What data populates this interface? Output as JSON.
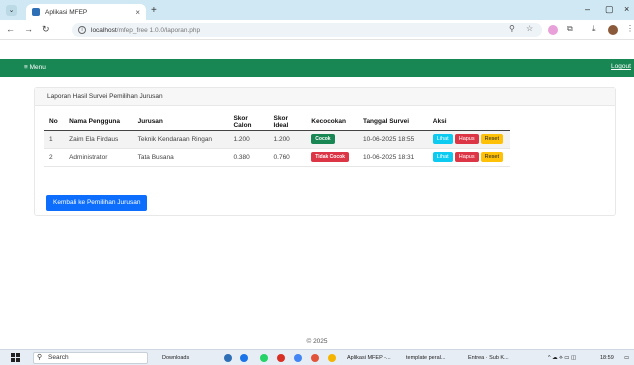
{
  "browser": {
    "tab_title": "Aplikasi MFEP",
    "tab_close": "×",
    "new_tab": "+",
    "url_host": "localhost",
    "url_path": "/mfep_free 1.0.0/laporan.php",
    "min": "–",
    "max": "▢",
    "close": "×"
  },
  "navbar": {
    "menu_label": "≡ Menu",
    "logout_label": "Logout"
  },
  "card": {
    "title": "Laporan Hasil Survei Pemilihan Jurusan"
  },
  "table": {
    "headers": [
      "No",
      "Nama Pengguna",
      "Jurusan",
      "Skor Calon",
      "Skor Ideal",
      "Kecocokan",
      "Tanggal Survei",
      "Aksi"
    ],
    "rows": [
      {
        "no": "1",
        "nama": "Zaim Ela Firdaus",
        "jurusan": "Teknik Kendaraan Ringan",
        "skor_calon": "1.200",
        "skor_ideal": "1.200",
        "kecocokan": "Cocok",
        "tanggal": "10-06-2025 18:55"
      },
      {
        "no": "2",
        "nama": "Administrator",
        "jurusan": "Tata Busana",
        "skor_calon": "0.380",
        "skor_ideal": "0.760",
        "kecocokan": "Tidak Cocok",
        "tanggal": "10-06-2025 18:31"
      }
    ],
    "actions": {
      "view": "Lihat",
      "delete": "Hapus",
      "reset": "Reset"
    }
  },
  "back_button": "Kembali ke Pemilihan Jurusan",
  "footer": "© 2025",
  "taskbar": {
    "search": "Search",
    "downloads": "Downloads",
    "app1": "Aplikasi MFEP -...",
    "app2": "template peral...",
    "app3": "Entrea · Sub K...",
    "clock": "18:59"
  },
  "colors": {
    "navbar": "#198754",
    "primary": "#0d6efd",
    "success": "#198754",
    "danger": "#dc3545",
    "info": "#0dcaf0",
    "warning": "#ffc107"
  }
}
